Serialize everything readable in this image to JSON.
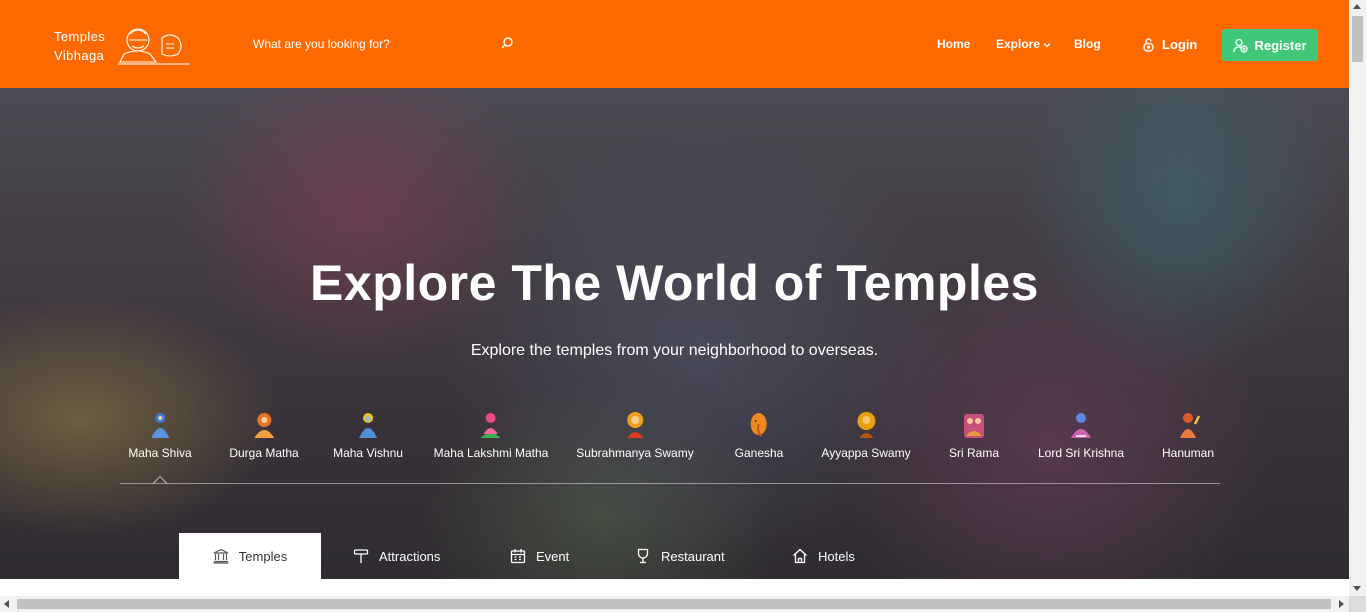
{
  "brand": {
    "line1": "Temples",
    "line2": "Vibhaga"
  },
  "search": {
    "placeholder": "What are you looking for?"
  },
  "nav": {
    "home": "Home",
    "explore": "Explore",
    "blog": "Blog"
  },
  "auth": {
    "login": "Login",
    "register": "Register"
  },
  "hero": {
    "title": "Explore The World of Temples",
    "subtitle": "Explore the temples from your neighborhood to overseas."
  },
  "deities": [
    {
      "label": "Maha Shiva",
      "color": "#3b7bd4"
    },
    {
      "label": "Durga Matha",
      "color": "#e8722a"
    },
    {
      "label": "Maha Vishnu",
      "color": "#4f8fd8"
    },
    {
      "label": "Maha Lakshmi Matha",
      "color": "#e94a8a"
    },
    {
      "label": "Subrahmanya Swamy",
      "color": "#f0a020"
    },
    {
      "label": "Ganesha",
      "color": "#f08a20"
    },
    {
      "label": "Ayyappa Swamy",
      "color": "#e8a010"
    },
    {
      "label": "Sri Rama",
      "color": "#c8507a"
    },
    {
      "label": "Lord Sri Krishna",
      "color": "#d060b0"
    },
    {
      "label": "Hanuman",
      "color": "#e05a28"
    }
  ],
  "tabs": [
    {
      "label": "Temples",
      "icon": "temple-icon"
    },
    {
      "label": "Attractions",
      "icon": "attraction-icon"
    },
    {
      "label": "Event",
      "icon": "calendar-icon"
    },
    {
      "label": "Restaurant",
      "icon": "glass-icon"
    },
    {
      "label": "Hotels",
      "icon": "home-icon"
    }
  ],
  "colors": {
    "header": "#ff6a00",
    "register": "#41c77a"
  }
}
